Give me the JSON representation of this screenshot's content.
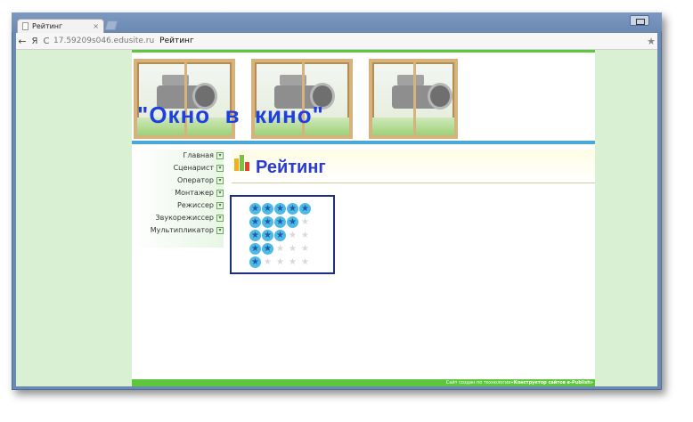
{
  "browser": {
    "tab_title": "Рейтинг",
    "tab_close": "×",
    "nav_back": "←",
    "nav_ya": "Я",
    "nav_reload": "C",
    "url": "17.59209s046.edusite.ru",
    "url_page_title": "Рейтинг",
    "bookmark_star": "★"
  },
  "site": {
    "banner_title": "\"Окно  в  кино\"",
    "accent_green": "#5cc63c",
    "accent_blue": "#4aa8d8",
    "title_blue": "#2a3ad4"
  },
  "menu": {
    "items": [
      {
        "label": "Главная"
      },
      {
        "label": "Сценарист"
      },
      {
        "label": "Оператор"
      },
      {
        "label": "Монтажер"
      },
      {
        "label": "Режиссер"
      },
      {
        "label": "Звукорежиссер"
      },
      {
        "label": "Мультипликатор"
      }
    ]
  },
  "content": {
    "page_title": "Рейтинг",
    "rating_rows": [
      5,
      4,
      3,
      2,
      1
    ],
    "rating_max": 5
  },
  "side_icons": [
    "home-icon",
    "film-camera-icon",
    "mail-icon"
  ],
  "footer": {
    "text": "Сайт создан по технологии ",
    "link": "«Конструктор сайтов e-Publish»"
  }
}
